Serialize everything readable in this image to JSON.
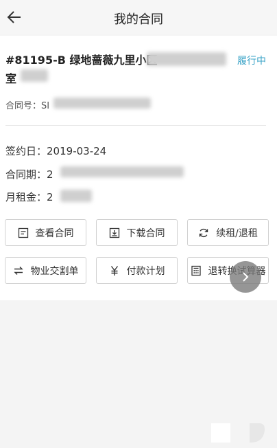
{
  "header": {
    "title": "我的合同"
  },
  "contract": {
    "address_line1": "#81195-B 绿地蔷薇九里小区",
    "address_line2": "室",
    "status": "履行中",
    "contract_no": "合同号：SI",
    "sign_date_label": "签约日：",
    "sign_date": "2019-03-24",
    "period_label": "合同期：",
    "period_value": "2",
    "rent_label": "月租金：",
    "rent_value": "2"
  },
  "actions": {
    "view": "查看合同",
    "download": "下载合同",
    "renew": "续租/退租",
    "handover": "物业交割单",
    "payment": "付款计划",
    "calculator": "退转换试算器"
  },
  "colors": {
    "status": "#3aa3c7",
    "border": "#d0d0d0"
  }
}
